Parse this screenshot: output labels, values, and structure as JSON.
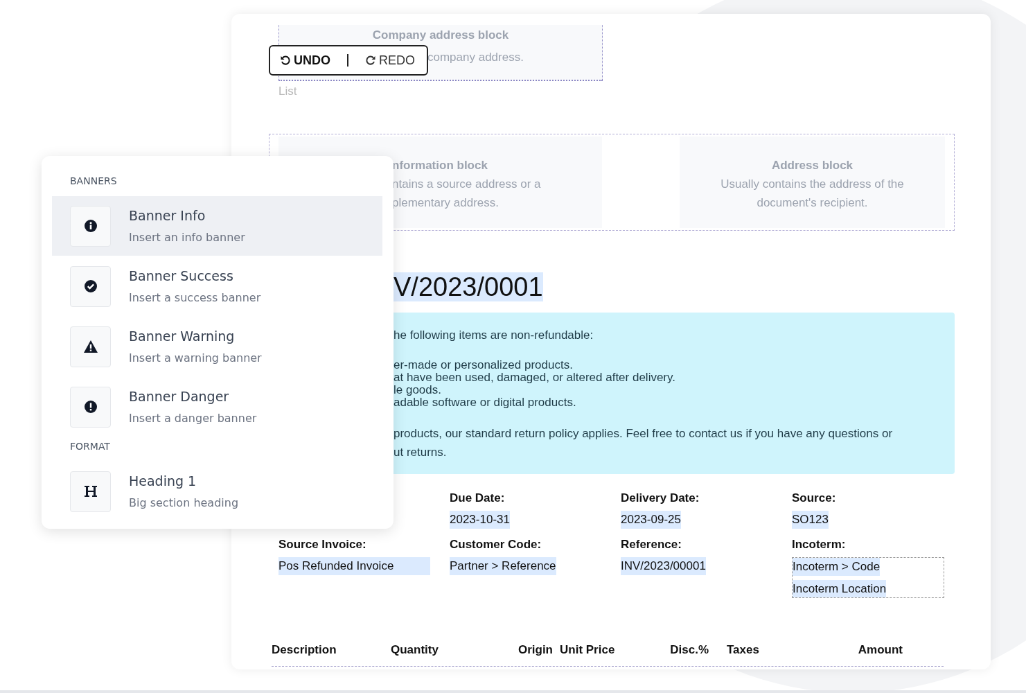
{
  "toolbar": {
    "undo": "UNDO",
    "redo": "REDO"
  },
  "company_block": {
    "title": "Company address block",
    "text": "company address."
  },
  "list_label": "List",
  "info_block": {
    "title": "nformation block",
    "lines": [
      "ntains a source address or a",
      "plementary address."
    ]
  },
  "address_block": {
    "title": "Address block",
    "lines": [
      "Usually contains the address of the",
      "document's recipient."
    ]
  },
  "document_title": "V/2023/0001",
  "banner": {
    "intro": "he following items are non-refundable:",
    "items": [
      "er-made or personalized products.",
      "at have been used, damaged, or altered after delivery.",
      "le goods.",
      "adable software or digital products."
    ],
    "outro": [
      "products, our standard return policy applies. Feel free to contact us if you have any questions or",
      "ut returns."
    ]
  },
  "fields": [
    {
      "label": "Due Date:",
      "values": [
        "2023-10-31"
      ]
    },
    {
      "label": "Delivery Date:",
      "values": [
        "2023-09-25"
      ]
    },
    {
      "label": "Source:",
      "values": [
        "SO123"
      ]
    },
    {
      "label": "Source Invoice:",
      "values": [
        "Pos Refunded Invoice"
      ]
    },
    {
      "label": "Customer Code:",
      "values": [
        "Partner > Reference"
      ]
    },
    {
      "label": "Reference:",
      "values": [
        "INV/2023/00001"
      ]
    },
    {
      "label": "Incoterm:",
      "values": [
        "Incoterm > Code",
        "Incoterm Location"
      ]
    }
  ],
  "table": {
    "columns": [
      "Description",
      "Quantity",
      "Origin",
      "Unit Price",
      "Disc.%",
      "Taxes",
      "Amount"
    ]
  },
  "menu": {
    "sections": [
      {
        "title": "BANNERS",
        "items": [
          {
            "kind": "info",
            "title": "Banner Info",
            "description": "Insert an info banner",
            "selected": true
          },
          {
            "kind": "success",
            "title": "Banner Success",
            "description": "Insert a success banner",
            "selected": false
          },
          {
            "kind": "warning",
            "title": "Banner Warning",
            "description": "Insert a warning banner",
            "selected": false
          },
          {
            "kind": "danger",
            "title": "Banner Danger",
            "description": "Insert a danger banner",
            "selected": false
          }
        ]
      },
      {
        "title": "FORMAT",
        "items": [
          {
            "kind": "heading",
            "title": "Heading 1",
            "description": "Big section heading",
            "selected": false
          }
        ]
      }
    ]
  }
}
